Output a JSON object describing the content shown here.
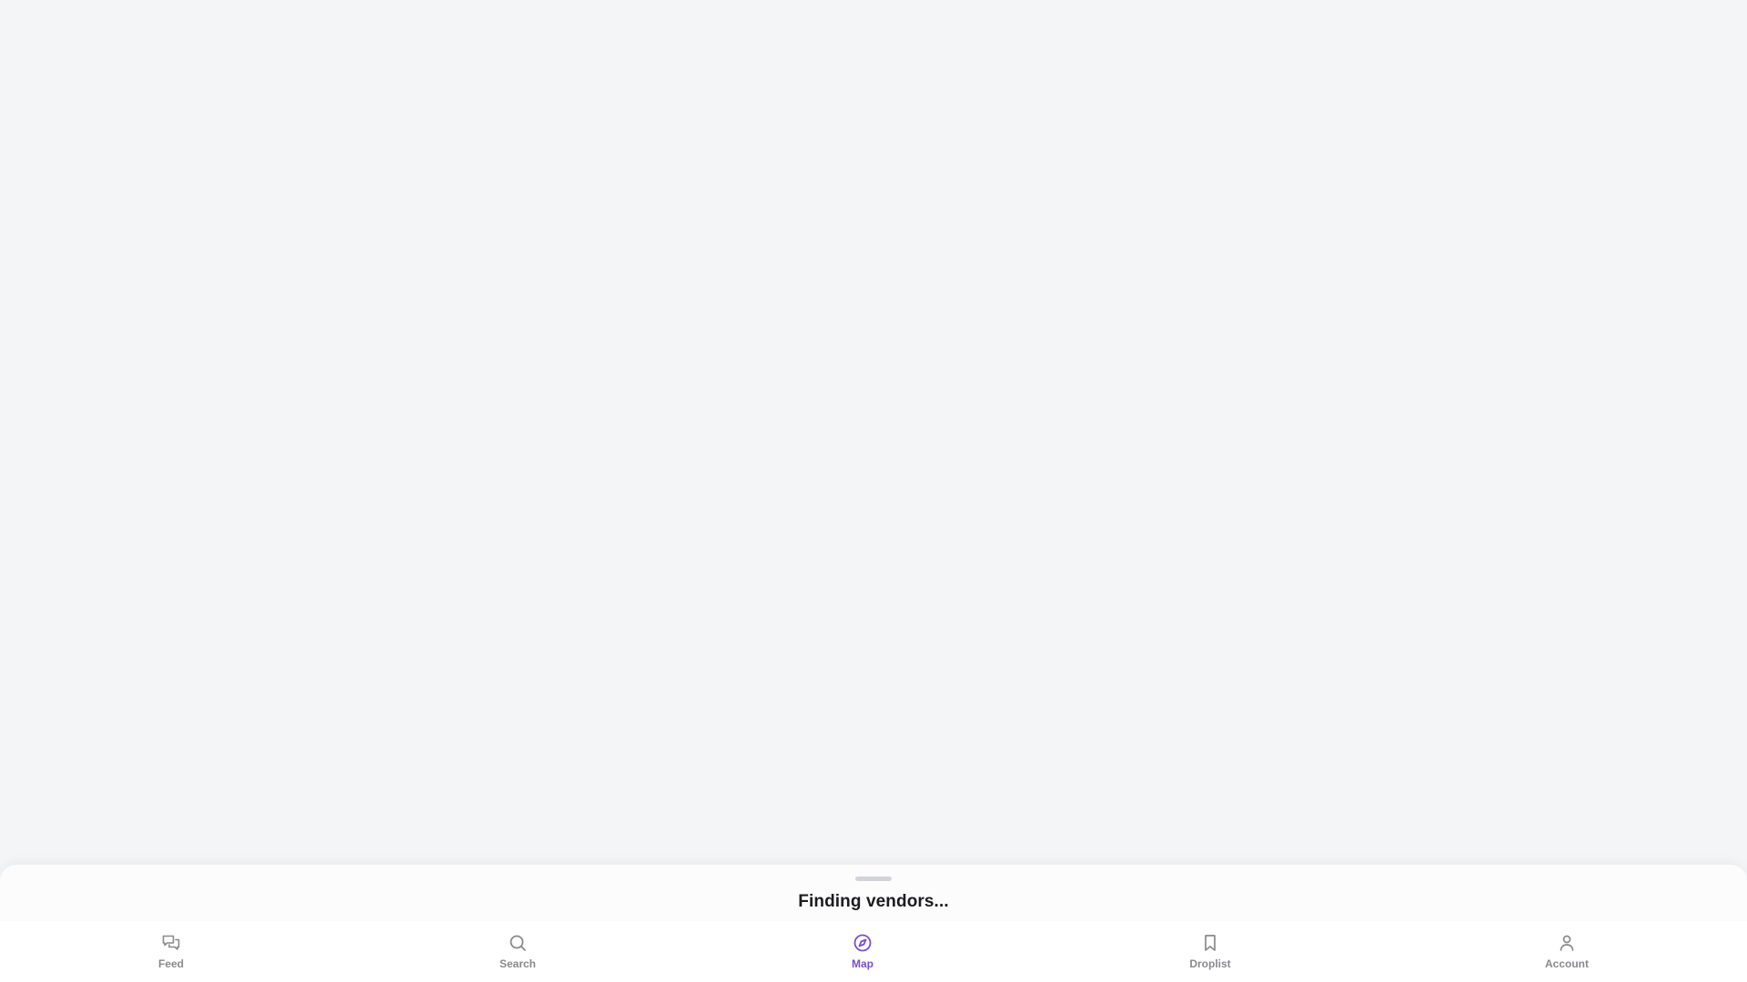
{
  "sheet": {
    "title": "Finding vendors..."
  },
  "tabs": [
    {
      "label": "Feed",
      "icon": "chat-bubbles-icon",
      "active": false
    },
    {
      "label": "Search",
      "icon": "search-icon",
      "active": false
    },
    {
      "label": "Map",
      "icon": "compass-icon",
      "active": true
    },
    {
      "label": "Droplist",
      "icon": "bookmark-icon",
      "active": false
    },
    {
      "label": "Account",
      "icon": "user-icon",
      "active": false
    }
  ],
  "colors": {
    "accent": "#7c4dce",
    "inactive": "#8a8a8e",
    "background": "#f4f5f7",
    "title_text": "#1c1c1e"
  }
}
